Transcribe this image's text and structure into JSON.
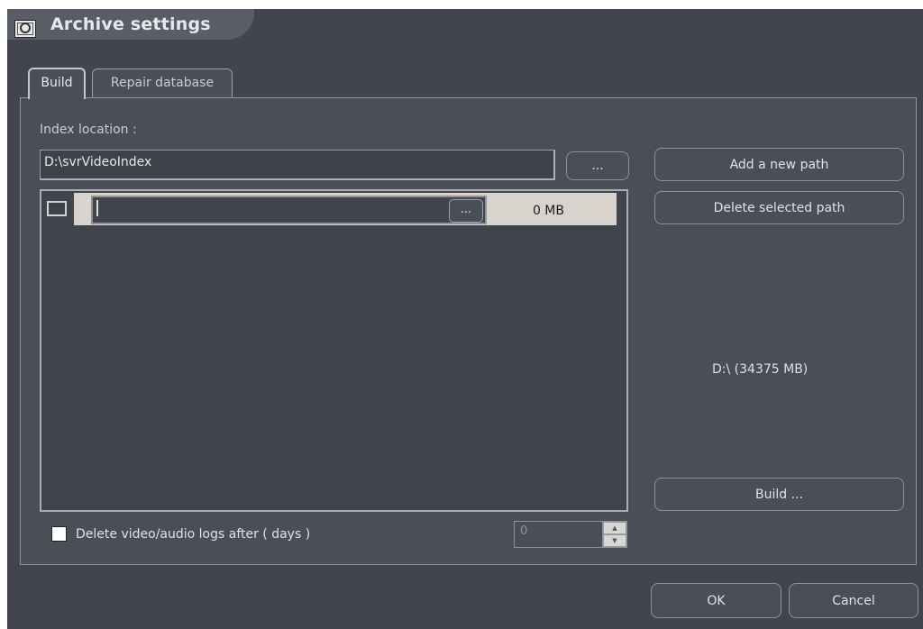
{
  "window": {
    "title": "Archive settings"
  },
  "tabs": [
    {
      "label": "Build",
      "active": true
    },
    {
      "label": "Repair database",
      "active": false
    }
  ],
  "build": {
    "index_label": "Index location :",
    "index_value": "D:\\svrVideoIndex",
    "browse_label": "...",
    "paths": [
      {
        "path": "",
        "browse_label": "...",
        "size": "0 MB",
        "checked": false
      }
    ],
    "add_path_label": "Add a new path",
    "delete_path_label": "Delete selected path",
    "drive_info": "D:\\  (34375 MB)",
    "build_label": "Build ...",
    "delete_logs_label": "Delete video/audio logs after ( days )",
    "delete_logs_checked": false,
    "days_value": "0"
  },
  "footer": {
    "ok_label": "OK",
    "cancel_label": "Cancel"
  },
  "colors": {
    "background": "#42454c",
    "panel": "#4a4e56",
    "row_highlight": "#d8d3cc",
    "text": "#d8dbe0"
  }
}
